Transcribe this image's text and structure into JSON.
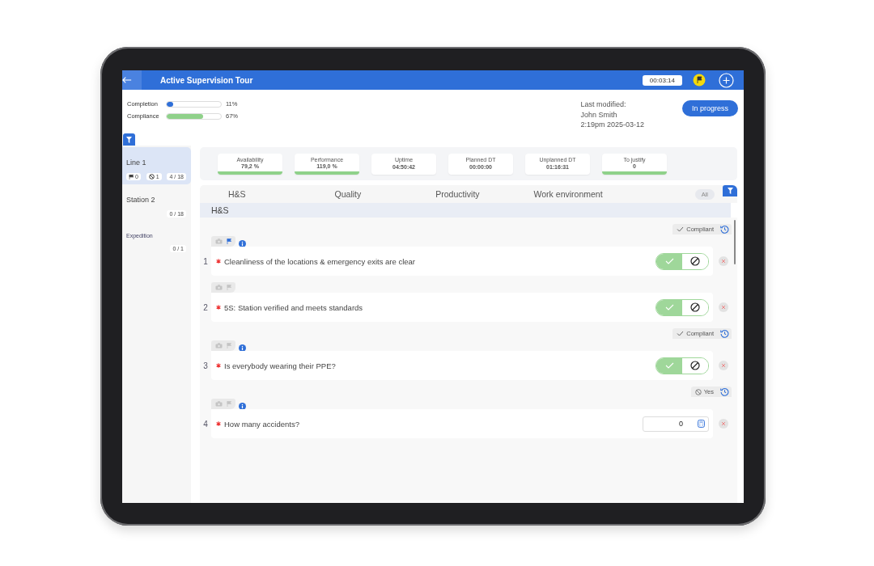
{
  "header": {
    "title": "Active Supervision Tour",
    "timer": "00:03:14"
  },
  "progress": [
    {
      "label": "Completion",
      "level": 0.11,
      "reading": "11%",
      "color": "#2f6fd8"
    },
    {
      "label": "Compliance",
      "level": 0.67,
      "reading": "67%",
      "color": "#8fd18a"
    }
  ],
  "last_modified": {
    "label": "Last modified:",
    "user": "John Smith",
    "time": "2:19pm 2025-03-12"
  },
  "status_button": "In progress",
  "sidebar": {
    "items": [
      {
        "kind": "station",
        "name": "Line 1",
        "selected": true,
        "flags": "0",
        "blocked": "1",
        "count": "4 / 18"
      },
      {
        "kind": "station",
        "name": "Station 2",
        "selected": false,
        "count": "0 / 18"
      },
      {
        "kind": "section",
        "name": "Expedition",
        "selected": false,
        "count": "0 / 1"
      }
    ]
  },
  "kpis": [
    {
      "label": "Availability",
      "value": "79,2 %",
      "indicator": true
    },
    {
      "label": "Performance",
      "value": "119,0 %",
      "indicator": true
    },
    {
      "label": "Uptime",
      "value": "04:50:42",
      "indicator": false
    },
    {
      "label": "Planned DT",
      "value": "00:00:00",
      "indicator": false
    },
    {
      "label": "Unplanned DT",
      "value": "01:16:31",
      "indicator": false
    },
    {
      "label": "To justify",
      "value": "0",
      "indicator": true
    }
  ],
  "tabs": [
    "H&S",
    "Quality",
    "Productivity",
    "Work environment"
  ],
  "filter_chip": "All",
  "section": "H&S",
  "questions": [
    {
      "number": "1",
      "text": "Cleanliness of the locations & emergency exits are clear",
      "kind": "toggle",
      "compliant": true,
      "flagged": true,
      "info": true,
      "status": {
        "kind": "check",
        "label": "Compliant"
      }
    },
    {
      "number": "2",
      "text": "5S: Station verified and meets standards",
      "kind": "toggle",
      "compliant": true,
      "flagged": false,
      "info": false
    },
    {
      "number": "3",
      "text": "Is everybody wearing their PPE?",
      "kind": "toggle",
      "compliant": true,
      "flagged": false,
      "info": true,
      "status": {
        "kind": "check",
        "label": "Compliant"
      }
    },
    {
      "number": "4",
      "text": "How many accidents?",
      "kind": "number",
      "value": "0",
      "flagged": false,
      "info": true,
      "status": {
        "kind": "blocked",
        "label": "Yes"
      }
    }
  ]
}
